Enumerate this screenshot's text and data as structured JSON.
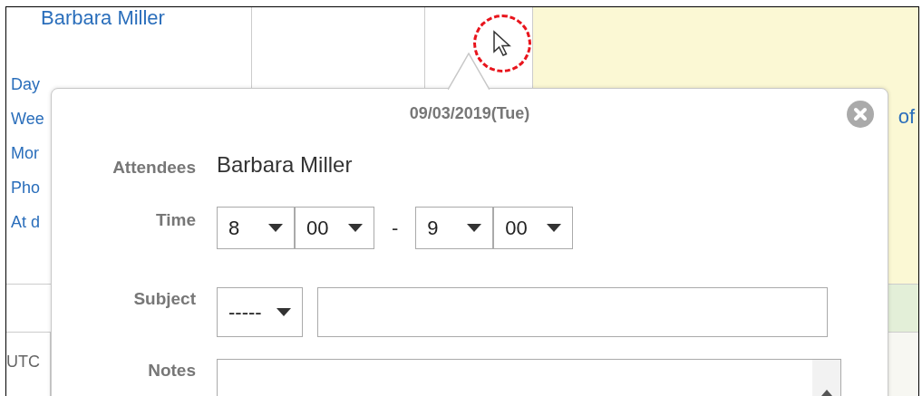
{
  "calendar": {
    "user": "Barbara Miller",
    "views": [
      {
        "label": "Day"
      },
      {
        "label": "Wee"
      },
      {
        "label": "Mor"
      },
      {
        "label": "Pho"
      },
      {
        "label": "At d"
      }
    ],
    "timezone": "UTC",
    "banner_link": "of"
  },
  "popup": {
    "date": "09/03/2019(Tue)",
    "fields": [
      {
        "kind": "text",
        "label": "Attendees",
        "value": "Barbara Miller"
      },
      {
        "kind": "time",
        "label": "Time",
        "start": [
          "8",
          "00"
        ],
        "separator": "-",
        "end": [
          "9",
          "00"
        ]
      },
      {
        "kind": "subject",
        "label": "Subject",
        "select": "-----"
      },
      {
        "kind": "notes",
        "label": "Notes"
      }
    ]
  }
}
